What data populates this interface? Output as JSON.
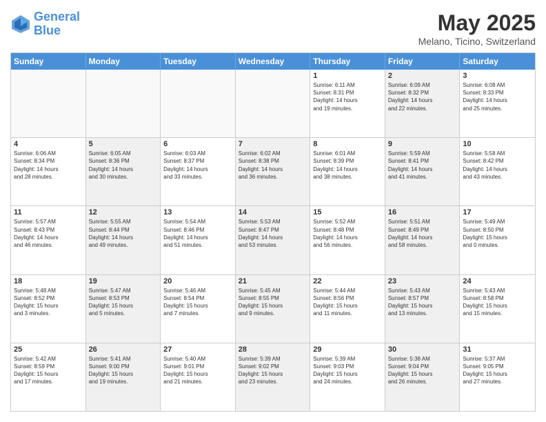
{
  "header": {
    "logo_line1": "General",
    "logo_line2": "Blue",
    "month_title": "May 2025",
    "location": "Melano, Ticino, Switzerland"
  },
  "days": [
    "Sunday",
    "Monday",
    "Tuesday",
    "Wednesday",
    "Thursday",
    "Friday",
    "Saturday"
  ],
  "weeks": [
    [
      {
        "day": "",
        "empty": true
      },
      {
        "day": "",
        "empty": true
      },
      {
        "day": "",
        "empty": true
      },
      {
        "day": "",
        "empty": true
      },
      {
        "day": "1",
        "lines": [
          "Sunrise: 6:11 AM",
          "Sunset: 8:31 PM",
          "Daylight: 14 hours",
          "and 19 minutes."
        ]
      },
      {
        "day": "2",
        "lines": [
          "Sunrise: 6:09 AM",
          "Sunset: 8:32 PM",
          "Daylight: 14 hours",
          "and 22 minutes."
        ],
        "shaded": true
      },
      {
        "day": "3",
        "lines": [
          "Sunrise: 6:08 AM",
          "Sunset: 8:33 PM",
          "Daylight: 14 hours",
          "and 25 minutes."
        ]
      }
    ],
    [
      {
        "day": "4",
        "lines": [
          "Sunrise: 6:06 AM",
          "Sunset: 8:34 PM",
          "Daylight: 14 hours",
          "and 28 minutes."
        ]
      },
      {
        "day": "5",
        "lines": [
          "Sunrise: 6:05 AM",
          "Sunset: 8:36 PM",
          "Daylight: 14 hours",
          "and 30 minutes."
        ],
        "shaded": true
      },
      {
        "day": "6",
        "lines": [
          "Sunrise: 6:03 AM",
          "Sunset: 8:37 PM",
          "Daylight: 14 hours",
          "and 33 minutes."
        ]
      },
      {
        "day": "7",
        "lines": [
          "Sunrise: 6:02 AM",
          "Sunset: 8:38 PM",
          "Daylight: 14 hours",
          "and 36 minutes."
        ],
        "shaded": true
      },
      {
        "day": "8",
        "lines": [
          "Sunrise: 6:01 AM",
          "Sunset: 8:39 PM",
          "Daylight: 14 hours",
          "and 38 minutes."
        ]
      },
      {
        "day": "9",
        "lines": [
          "Sunrise: 5:59 AM",
          "Sunset: 8:41 PM",
          "Daylight: 14 hours",
          "and 41 minutes."
        ],
        "shaded": true
      },
      {
        "day": "10",
        "lines": [
          "Sunrise: 5:58 AM",
          "Sunset: 8:42 PM",
          "Daylight: 14 hours",
          "and 43 minutes."
        ]
      }
    ],
    [
      {
        "day": "11",
        "lines": [
          "Sunrise: 5:57 AM",
          "Sunset: 8:43 PM",
          "Daylight: 14 hours",
          "and 46 minutes."
        ]
      },
      {
        "day": "12",
        "lines": [
          "Sunrise: 5:55 AM",
          "Sunset: 8:44 PM",
          "Daylight: 14 hours",
          "and 49 minutes."
        ],
        "shaded": true
      },
      {
        "day": "13",
        "lines": [
          "Sunrise: 5:54 AM",
          "Sunset: 8:46 PM",
          "Daylight: 14 hours",
          "and 51 minutes."
        ]
      },
      {
        "day": "14",
        "lines": [
          "Sunrise: 5:53 AM",
          "Sunset: 8:47 PM",
          "Daylight: 14 hours",
          "and 53 minutes."
        ],
        "shaded": true
      },
      {
        "day": "15",
        "lines": [
          "Sunrise: 5:52 AM",
          "Sunset: 8:48 PM",
          "Daylight: 14 hours",
          "and 56 minutes."
        ]
      },
      {
        "day": "16",
        "lines": [
          "Sunrise: 5:51 AM",
          "Sunset: 8:49 PM",
          "Daylight: 14 hours",
          "and 58 minutes."
        ],
        "shaded": true
      },
      {
        "day": "17",
        "lines": [
          "Sunrise: 5:49 AM",
          "Sunset: 8:50 PM",
          "Daylight: 15 hours",
          "and 0 minutes."
        ]
      }
    ],
    [
      {
        "day": "18",
        "lines": [
          "Sunrise: 5:48 AM",
          "Sunset: 8:52 PM",
          "Daylight: 15 hours",
          "and 3 minutes."
        ]
      },
      {
        "day": "19",
        "lines": [
          "Sunrise: 5:47 AM",
          "Sunset: 8:53 PM",
          "Daylight: 15 hours",
          "and 5 minutes."
        ],
        "shaded": true
      },
      {
        "day": "20",
        "lines": [
          "Sunrise: 5:46 AM",
          "Sunset: 8:54 PM",
          "Daylight: 15 hours",
          "and 7 minutes."
        ]
      },
      {
        "day": "21",
        "lines": [
          "Sunrise: 5:45 AM",
          "Sunset: 8:55 PM",
          "Daylight: 15 hours",
          "and 9 minutes."
        ],
        "shaded": true
      },
      {
        "day": "22",
        "lines": [
          "Sunrise: 5:44 AM",
          "Sunset: 8:56 PM",
          "Daylight: 15 hours",
          "and 11 minutes."
        ]
      },
      {
        "day": "23",
        "lines": [
          "Sunrise: 5:43 AM",
          "Sunset: 8:57 PM",
          "Daylight: 15 hours",
          "and 13 minutes."
        ],
        "shaded": true
      },
      {
        "day": "24",
        "lines": [
          "Sunrise: 5:43 AM",
          "Sunset: 8:58 PM",
          "Daylight: 15 hours",
          "and 15 minutes."
        ]
      }
    ],
    [
      {
        "day": "25",
        "lines": [
          "Sunrise: 5:42 AM",
          "Sunset: 8:59 PM",
          "Daylight: 15 hours",
          "and 17 minutes."
        ]
      },
      {
        "day": "26",
        "lines": [
          "Sunrise: 5:41 AM",
          "Sunset: 9:00 PM",
          "Daylight: 15 hours",
          "and 19 minutes."
        ],
        "shaded": true
      },
      {
        "day": "27",
        "lines": [
          "Sunrise: 5:40 AM",
          "Sunset: 9:01 PM",
          "Daylight: 15 hours",
          "and 21 minutes."
        ]
      },
      {
        "day": "28",
        "lines": [
          "Sunrise: 5:39 AM",
          "Sunset: 9:02 PM",
          "Daylight: 15 hours",
          "and 23 minutes."
        ],
        "shaded": true
      },
      {
        "day": "29",
        "lines": [
          "Sunrise: 5:39 AM",
          "Sunset: 9:03 PM",
          "Daylight: 15 hours",
          "and 24 minutes."
        ]
      },
      {
        "day": "30",
        "lines": [
          "Sunrise: 5:38 AM",
          "Sunset: 9:04 PM",
          "Daylight: 15 hours",
          "and 26 minutes."
        ],
        "shaded": true
      },
      {
        "day": "31",
        "lines": [
          "Sunrise: 5:37 AM",
          "Sunset: 9:05 PM",
          "Daylight: 15 hours",
          "and 27 minutes."
        ]
      }
    ]
  ]
}
